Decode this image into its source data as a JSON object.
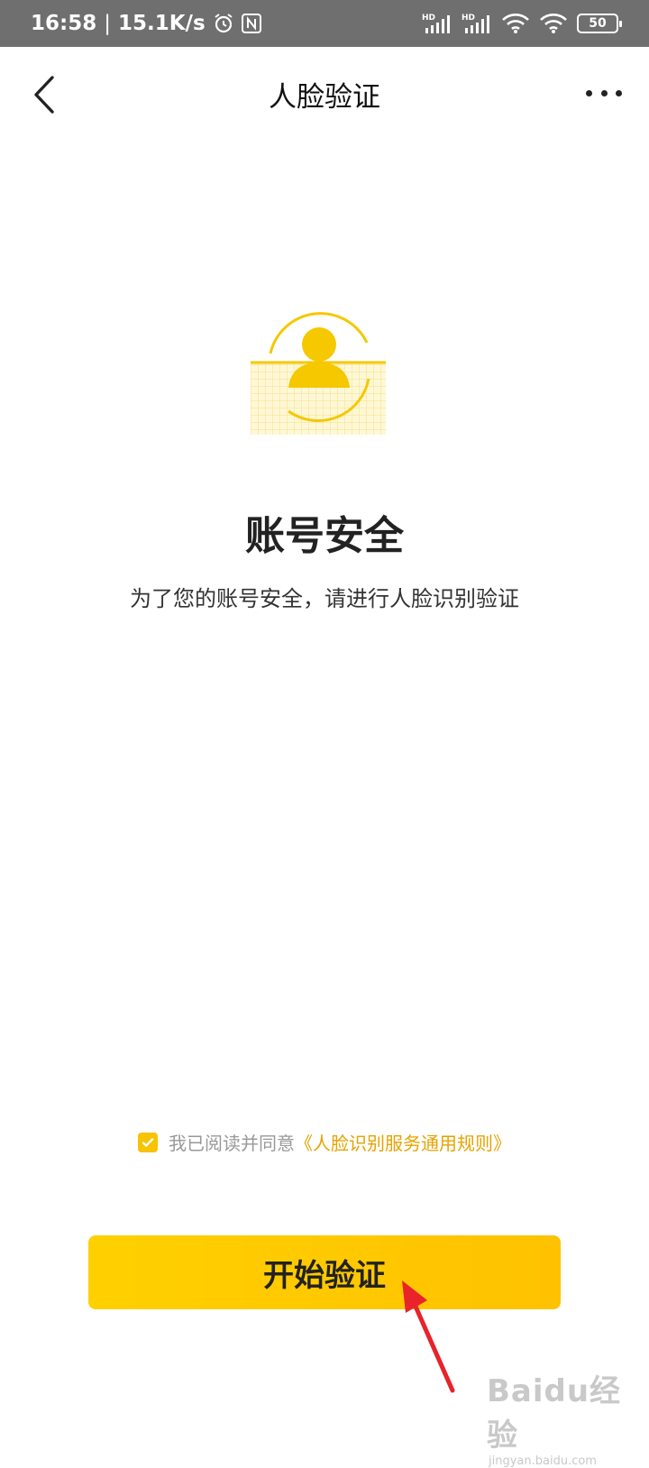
{
  "status_bar": {
    "time": "16:58",
    "separator": "|",
    "speed": "15.1K/s",
    "icons": [
      "alarm-icon",
      "nfc-icon",
      "signal-hd-icon",
      "signal-hd-icon",
      "wifi-icon",
      "wifi-icon"
    ],
    "battery": "50"
  },
  "navbar": {
    "back_icon": "chevron-left-icon",
    "title": "人脸验证",
    "more_icon": "more-dots-icon"
  },
  "main": {
    "hero_icon": "face-user-icon",
    "heading": "账号安全",
    "subtext": "为了您的账号安全，请进行人脸识别验证"
  },
  "agreement": {
    "checked": true,
    "prefix": "我已阅读并同意",
    "link": "《人脸识别服务通用规则》"
  },
  "button": {
    "label": "开始验证"
  },
  "watermark": {
    "main": "Baidu经验",
    "sub": "jingyan.baidu.com"
  },
  "colors": {
    "accent": "#FFCB00",
    "link": "#E6A300",
    "arrow": "#E8232A"
  }
}
